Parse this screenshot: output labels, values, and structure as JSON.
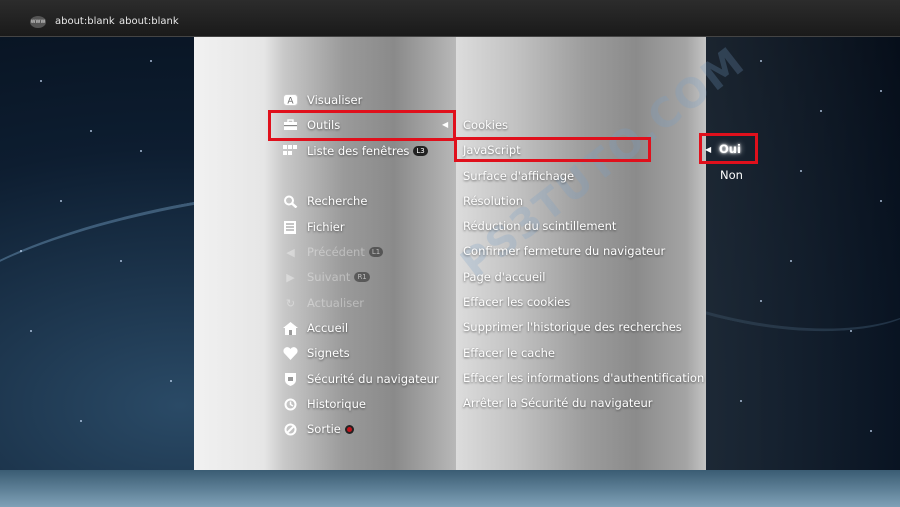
{
  "topbar": {
    "icon": "www-icon",
    "icon_text": "www",
    "title1": "about:blank",
    "title2": "about:blank"
  },
  "menu": {
    "items": [
      {
        "label": "Visualiser",
        "icon": "a-button-icon",
        "enabled": true
      },
      {
        "label": "Outils",
        "icon": "toolbox-icon",
        "enabled": true,
        "selected": true
      },
      {
        "label": "Liste des fenêtres",
        "icon": "grid-icon",
        "badge": "L3",
        "enabled": true
      },
      {
        "label": "Recherche",
        "icon": "search-icon",
        "enabled": true
      },
      {
        "label": "Fichier",
        "icon": "file-icon",
        "enabled": true
      },
      {
        "label": "Précédent",
        "icon": "back-icon",
        "badge": "L1",
        "enabled": false
      },
      {
        "label": "Suivant",
        "icon": "forward-icon",
        "badge": "R1",
        "enabled": false
      },
      {
        "label": "Actualiser",
        "icon": "refresh-icon",
        "enabled": false
      },
      {
        "label": "Accueil",
        "icon": "home-icon",
        "enabled": true
      },
      {
        "label": "Signets",
        "icon": "heart-icon",
        "enabled": true
      },
      {
        "label": "Sécurité du navigateur",
        "icon": "shield-icon",
        "enabled": true
      },
      {
        "label": "Historique",
        "icon": "history-icon",
        "enabled": true
      },
      {
        "label": "Sortie",
        "icon": "exit-icon",
        "enabled": true
      }
    ]
  },
  "submenu": {
    "items": [
      {
        "label": "Cookies"
      },
      {
        "label": "JavaScript",
        "selected": true
      },
      {
        "label": "Surface d'affichage"
      },
      {
        "label": "Résolution"
      },
      {
        "label": "Réduction du scintillement"
      },
      {
        "label": "Confirmer fermeture du navigateur"
      },
      {
        "label": "Page d'accueil"
      },
      {
        "label": "Effacer les cookies"
      },
      {
        "label": "Supprimer l'historique des recherches"
      },
      {
        "label": "Effacer le cache"
      },
      {
        "label": "Effacer les informations d'authentification"
      },
      {
        "label": "Arrêter la Sécurité du navigateur"
      }
    ]
  },
  "options": {
    "items": [
      {
        "label": "Oui",
        "selected": true
      },
      {
        "label": "Non"
      }
    ]
  },
  "colors": {
    "highlight": "#e0101c",
    "text": "#ffffff"
  }
}
